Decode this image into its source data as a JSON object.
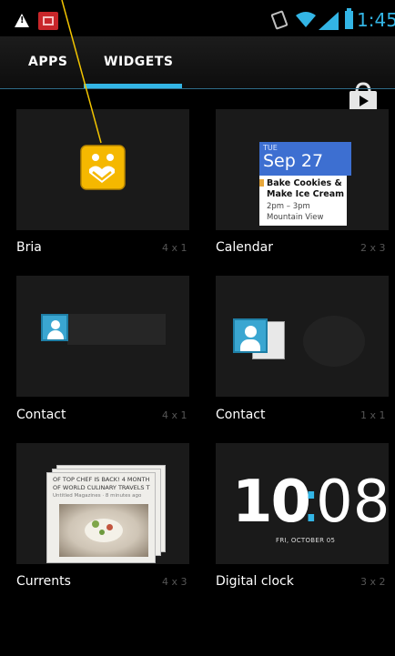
{
  "status_bar": {
    "time": "1:45",
    "icons": [
      "warning-icon",
      "notification-app-icon",
      "vibrate-icon",
      "wifi-icon",
      "signal-icon",
      "battery-icon"
    ]
  },
  "tabs": [
    {
      "label": "APPS",
      "selected": false
    },
    {
      "label": "WIDGETS",
      "selected": true
    }
  ],
  "store_icon": "play-store-icon",
  "widgets": [
    {
      "name": "Bria",
      "size": "4 x 1"
    },
    {
      "name": "Calendar",
      "size": "2 x 3"
    },
    {
      "name": "Contact",
      "size": "4 x 1"
    },
    {
      "name": "Contact",
      "size": "1 x 1"
    },
    {
      "name": "Currents",
      "size": "4 x 3"
    },
    {
      "name": "Digital clock",
      "size": "3 x 2"
    }
  ],
  "calendar_preview": {
    "day_of_week": "TUE",
    "date": "Sep 27",
    "event_line1": "Bake Cookies &",
    "event_line2": "Make Ice Cream",
    "event_time": "2pm – 3pm",
    "event_location": "Mountain View"
  },
  "clock_preview": {
    "hour": "10",
    "minute": "08",
    "date": "FRI, OCTOBER 05"
  },
  "currents_preview": {
    "line1": "OF TOP CHEF IS BACK! 4 MONTH",
    "line2": "OF WORLD CULINARY TRAVELS T",
    "line3": "Untitled Magazines · 8 minutes ago"
  },
  "colors": {
    "accent": "#33b5e5",
    "callout": "#f2c400",
    "tile_background": "#1a1a1a",
    "bria_icon": "#f5b800"
  }
}
